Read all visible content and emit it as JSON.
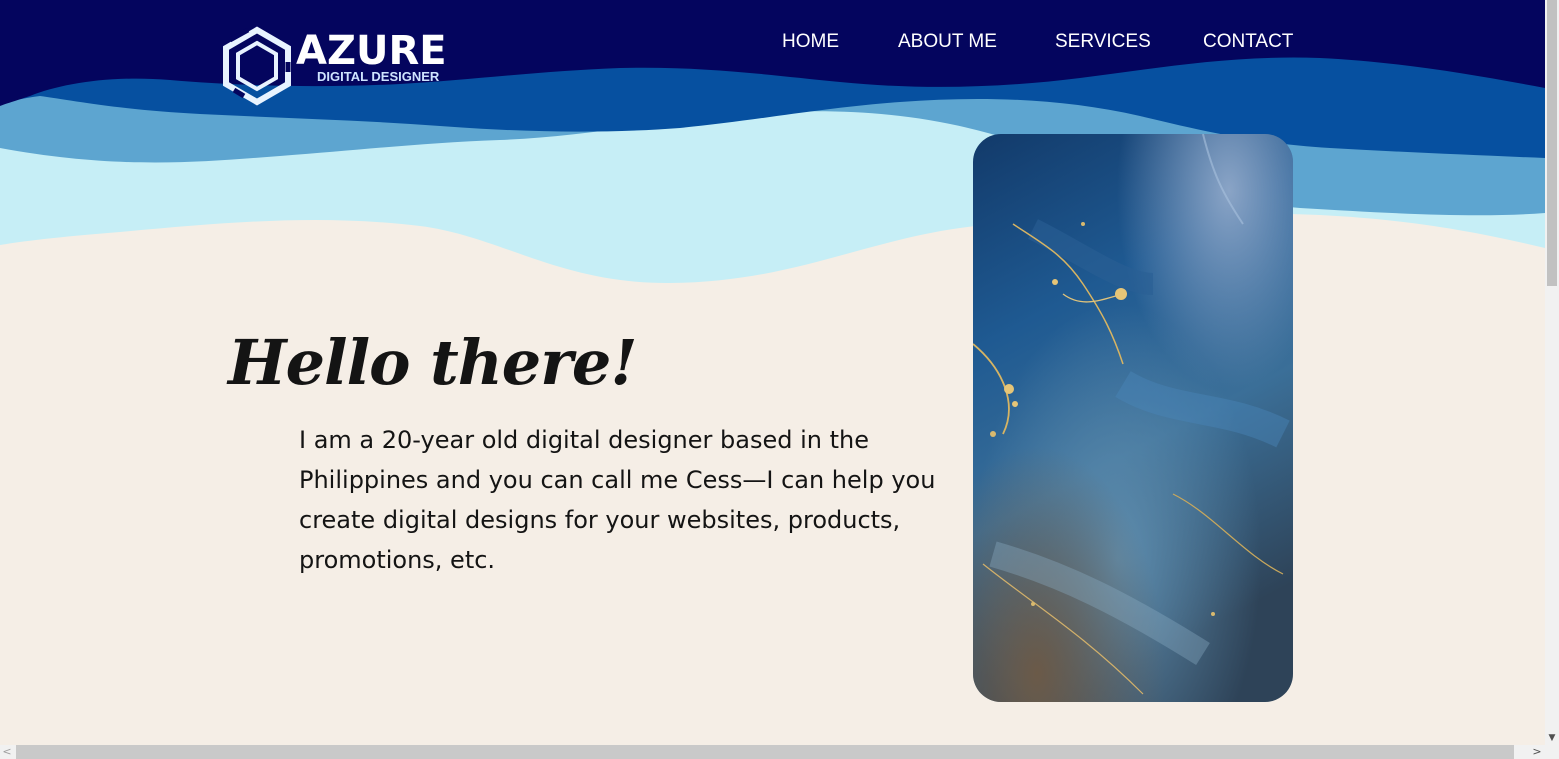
{
  "header": {
    "logo": {
      "title": "AZURE",
      "subtitle": "DIGITAL DESIGNER",
      "icon": "hexagon-logo-icon"
    },
    "nav": [
      {
        "label": "HOME"
      },
      {
        "label": "ABOUT ME"
      },
      {
        "label": "SERVICES"
      },
      {
        "label": "CONTACT"
      }
    ]
  },
  "hero": {
    "greeting": "Hello there!",
    "intro": "I am a 20-year old digital designer based in the Philippines and you can call me Cess—I can help you create digital designs for your websites, products, promotions, etc.",
    "image": "blue-gold-marble-image"
  },
  "scrollbars": {
    "up_arrow": "▲",
    "down_arrow": "▼",
    "left_arrow": "<",
    "right_arrow": ">"
  },
  "colors": {
    "navy": "#04055e",
    "mid_blue": "#0650a0",
    "steel_blue": "#5da5d0",
    "light_cyan": "#c6eef6",
    "cream": "#f5eee6",
    "text": "#141414"
  }
}
